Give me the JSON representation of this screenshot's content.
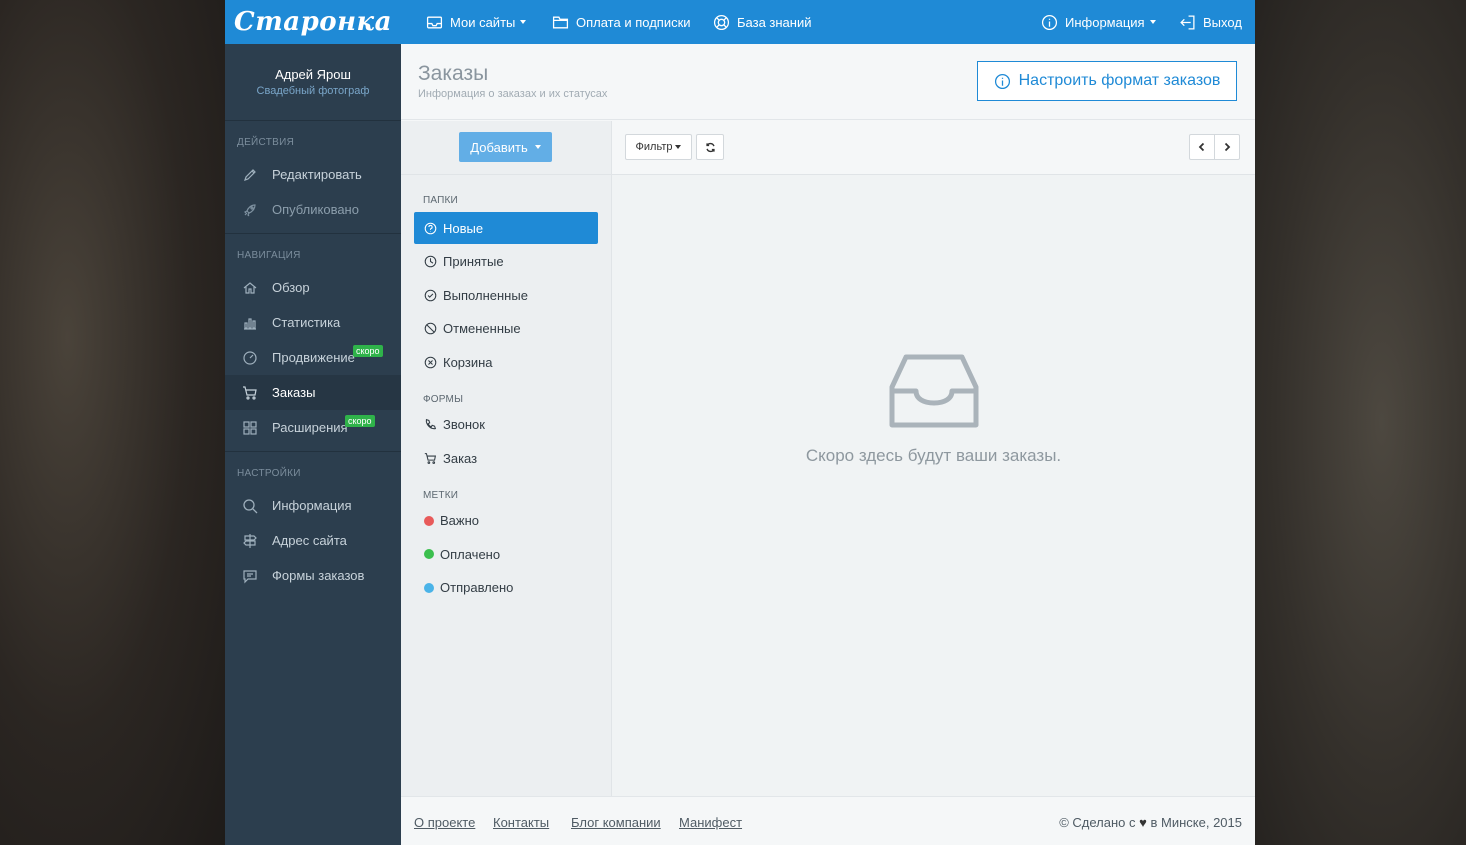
{
  "brand": {
    "logo": "Старонка",
    "color": "#1f8ad6"
  },
  "profile": {
    "name": "Адрей Ярош",
    "role": "Свадебный фотограф"
  },
  "sidebar": {
    "actions_title": "Действия",
    "actions": [
      {
        "label": "Редактировать",
        "icon": "pencil-icon"
      },
      {
        "label": "Опубликовано",
        "icon": "rocket-icon"
      }
    ],
    "navigation_title": "Навигация",
    "navigation": [
      {
        "label": "Обзор",
        "icon": "home-icon"
      },
      {
        "label": "Статистика",
        "icon": "bar-chart-icon"
      },
      {
        "label": "Продвижение",
        "icon": "gauge-icon",
        "badge": "скоро"
      },
      {
        "label": "Заказы",
        "icon": "cart-icon",
        "active": true
      },
      {
        "label": "Расширения",
        "icon": "grid-icon",
        "badge": "скоро"
      }
    ],
    "settings_title": "Настройки",
    "settings": [
      {
        "label": "Информация",
        "icon": "search-icon"
      },
      {
        "label": "Адрес сайта",
        "icon": "signpost-icon"
      },
      {
        "label": "Формы заказов",
        "icon": "chat-icon"
      }
    ]
  },
  "topbar": {
    "my_sites": "Мои сайты",
    "payments": "Оплата и подписки",
    "knowledge": "База знаний",
    "info": "Информация",
    "logout": "Выход"
  },
  "header": {
    "title": "Заказы",
    "subtitle": "Информация о заказах и их статусах",
    "config_button": "Настроить формат заказов"
  },
  "folders": {
    "add_button": "Добавить",
    "folders_title": "Папки",
    "folders": [
      {
        "label": "Новые",
        "icon": "question-circle-icon",
        "active": true
      },
      {
        "label": "Принятые",
        "icon": "clock-icon"
      },
      {
        "label": "Выполненные",
        "icon": "check-circle-icon"
      },
      {
        "label": "Отмененные",
        "icon": "ban-icon"
      },
      {
        "label": "Корзина",
        "icon": "x-circle-icon"
      }
    ],
    "forms_title": "Формы",
    "forms": [
      {
        "label": "Звонок",
        "icon": "phone-icon"
      },
      {
        "label": "Заказ",
        "icon": "cart-icon"
      }
    ],
    "tags_title": "Метки",
    "tags": [
      {
        "label": "Важно",
        "color": "#e85a5a"
      },
      {
        "label": "Оплачено",
        "color": "#3bbf4e"
      },
      {
        "label": "Отправлено",
        "color": "#4ab3e8"
      }
    ]
  },
  "main": {
    "filter_button": "Фильтр",
    "empty_text": "Скоро здесь будут ваши заказы."
  },
  "footer": {
    "links": [
      "О проекте",
      "Контакты",
      "Блог компании",
      "Манифест"
    ],
    "copyright_pre": "© Сделано с",
    "copyright_post": "в Минске, 2015"
  }
}
